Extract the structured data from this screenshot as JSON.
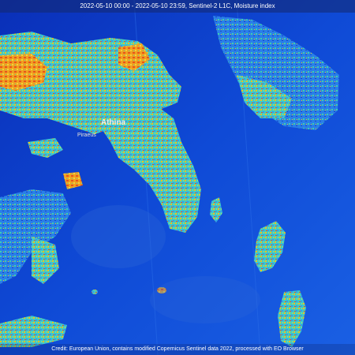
{
  "header": {
    "title": "2022-05-10 00:00 - 2022-05-10 23:59, Sentinel-2 L1C, Moisture index"
  },
  "footer": {
    "credit": "Credit: European Union, contains modified Copernicus Sentinel data 2022, processed with EO Browser"
  },
  "map": {
    "layer": "Moisture index",
    "colors": {
      "sea": "#0a36c8",
      "sea_light": "#1d66e8",
      "dry": "#e8541c",
      "moderate": "#f0c419",
      "moist": "#3ecfb0",
      "wet": "#2fa6f0"
    }
  },
  "places": [
    {
      "name": "Athina"
    },
    {
      "name": "Piraeus"
    }
  ]
}
